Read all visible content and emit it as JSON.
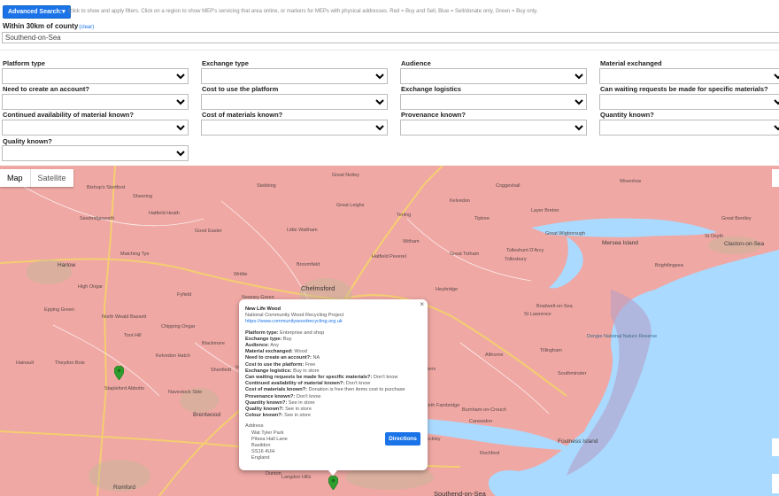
{
  "header": {
    "advanced_search_label": "Advanced Search:▾",
    "help_text": "Click to show and apply filters. Click on a region to show MEP's servicing that area online, or markers for MEPs with physical addresses. Red = Buy and Sell, Blue = Sell/donate only, Green = Buy only.",
    "county_label": "Within 30km of county",
    "county_clear": "(clear)",
    "county_value": "Southend-on-Sea"
  },
  "filters": [
    {
      "label": "Platform type"
    },
    {
      "label": "Exchange type"
    },
    {
      "label": "Audience"
    },
    {
      "label": "Material exchanged"
    },
    {
      "label": "Need to create an account?"
    },
    {
      "label": "Cost to use the platform"
    },
    {
      "label": "Exchange logistics"
    },
    {
      "label": "Can waiting requests be made for specific materials?"
    },
    {
      "label": "Continued availability of material known?"
    },
    {
      "label": "Cost of materials known?"
    },
    {
      "label": "Provenance known?"
    },
    {
      "label": "Quantity known?"
    },
    {
      "label": "Quality known?"
    }
  ],
  "map": {
    "type_map": "Map",
    "type_satellite": "Satellite",
    "region_color": "#efa8a4",
    "sea_color": "#aadaff",
    "marker_color": "#2e9e2e",
    "places": [
      {
        "name": "Chelmsford",
        "cls": "big"
      },
      {
        "name": "Harlow",
        "cls": "town"
      },
      {
        "name": "Brentwood",
        "cls": "town"
      },
      {
        "name": "Romford",
        "cls": "town"
      },
      {
        "name": "Basildon",
        "cls": "town"
      },
      {
        "name": "Southend-on-Sea",
        "cls": "big"
      },
      {
        "name": "Clacton-on-Sea",
        "cls": "town"
      },
      {
        "name": "Foulness Island",
        "cls": "town"
      },
      {
        "name": "Mersea Island",
        "cls": "town"
      },
      {
        "name": "Burnham-on-Crouch",
        "cls": ""
      },
      {
        "name": "Dengie National Nature Reserve",
        "cls": "water"
      },
      {
        "name": "Epping Green",
        "cls": ""
      },
      {
        "name": "North Weald Bassett",
        "cls": ""
      },
      {
        "name": "Stapleford Abbotts",
        "cls": ""
      },
      {
        "name": "Theydon Bois",
        "cls": ""
      },
      {
        "name": "Toot Hill",
        "cls": ""
      },
      {
        "name": "Blackmore",
        "cls": ""
      },
      {
        "name": "Maldon",
        "cls": "town"
      },
      {
        "name": "Great Notley",
        "cls": ""
      },
      {
        "name": "Great Leighs",
        "cls": ""
      },
      {
        "name": "Terling",
        "cls": ""
      },
      {
        "name": "Tiptree",
        "cls": ""
      },
      {
        "name": "Tollesbury",
        "cls": ""
      },
      {
        "name": "Tolleshunt D'Arcy",
        "cls": ""
      },
      {
        "name": "St Lawrence",
        "cls": ""
      },
      {
        "name": "Bradwell-on-Sea",
        "cls": ""
      },
      {
        "name": "Tillingham",
        "cls": ""
      },
      {
        "name": "Canewdon",
        "cls": ""
      },
      {
        "name": "Hockley",
        "cls": ""
      },
      {
        "name": "Bishop's Stortford",
        "cls": ""
      },
      {
        "name": "Sawbridgeworth",
        "cls": ""
      },
      {
        "name": "Hatfield Heath",
        "cls": ""
      },
      {
        "name": "Matching Tye",
        "cls": ""
      },
      {
        "name": "High Ongar",
        "cls": ""
      },
      {
        "name": "Fyfield",
        "cls": ""
      },
      {
        "name": "Writtle",
        "cls": ""
      },
      {
        "name": "Broomfield",
        "cls": ""
      },
      {
        "name": "Little Baddow",
        "cls": ""
      },
      {
        "name": "Witham",
        "cls": ""
      },
      {
        "name": "Great Totham",
        "cls": ""
      },
      {
        "name": "Heybridge",
        "cls": ""
      },
      {
        "name": "Great Wigborough",
        "cls": ""
      },
      {
        "name": "Layer Breton",
        "cls": ""
      },
      {
        "name": "Kelvedon",
        "cls": ""
      },
      {
        "name": "St Osyth",
        "cls": ""
      },
      {
        "name": "Great Bentley",
        "cls": ""
      },
      {
        "name": "Wivenhoe",
        "cls": ""
      },
      {
        "name": "Rochford",
        "cls": ""
      },
      {
        "name": "South Woodham Ferrers",
        "cls": ""
      },
      {
        "name": "Rayleigh",
        "cls": ""
      },
      {
        "name": "Langdon Hills",
        "cls": ""
      },
      {
        "name": "Kelvedon Hatch",
        "cls": ""
      },
      {
        "name": "Navestock Side",
        "cls": ""
      },
      {
        "name": "Chipping Ongar",
        "cls": ""
      },
      {
        "name": "Hainault",
        "cls": ""
      },
      {
        "name": "Sheering",
        "cls": ""
      },
      {
        "name": "Good Easter",
        "cls": ""
      },
      {
        "name": "Newney Green",
        "cls": ""
      },
      {
        "name": "Latchingdon",
        "cls": ""
      },
      {
        "name": "North Fambridge",
        "cls": ""
      },
      {
        "name": "Althorne",
        "cls": ""
      },
      {
        "name": "Southminster",
        "cls": ""
      },
      {
        "name": "Stebbing",
        "cls": ""
      },
      {
        "name": "Coggeshall",
        "cls": ""
      },
      {
        "name": "Brightlingsea",
        "cls": ""
      },
      {
        "name": "Little Waltham",
        "cls": ""
      },
      {
        "name": "Hatfield Peverel",
        "cls": ""
      },
      {
        "name": "Ingatestone",
        "cls": ""
      },
      {
        "name": "Shenfield",
        "cls": ""
      },
      {
        "name": "Billericay",
        "cls": ""
      },
      {
        "name": "Wickford",
        "cls": ""
      },
      {
        "name": "Dunton",
        "cls": ""
      }
    ]
  },
  "popup": {
    "close": "×",
    "name": "New Life Wood",
    "org": "National Community Wood Recycling Project",
    "url": "https://www.communitywoodrecycling.org.uk",
    "rows": [
      {
        "k": "Platform type:",
        "v": "Enterprise and shop"
      },
      {
        "k": "Exchange type:",
        "v": "Buy"
      },
      {
        "k": "Audience:",
        "v": "Any"
      },
      {
        "k": "Material exchanged:",
        "v": "Wood"
      },
      {
        "k": "Need to create an account?:",
        "v": "NA"
      },
      {
        "k": "Cost to use the platform:",
        "v": "Free"
      },
      {
        "k": "Exchange logistics:",
        "v": "Buy in store"
      },
      {
        "k": "Can waiting requests be made for specific materials?:",
        "v": "Don't know"
      },
      {
        "k": "Continued availability of material known?:",
        "v": "Don't know"
      },
      {
        "k": "Cost of materials known?:",
        "v": "Donation is free then items cost to purchase"
      },
      {
        "k": "Provenance known?:",
        "v": "Don't know"
      },
      {
        "k": "Quantity known?:",
        "v": "See in store"
      },
      {
        "k": "Quality known?:",
        "v": "See in store"
      },
      {
        "k": "Colour known?:",
        "v": "See in store"
      }
    ],
    "address_label": "Address",
    "address": [
      "Wat Tyler Park",
      "Pitsea Hall Lane",
      "Basildon",
      "SS16 4UH",
      "England"
    ],
    "directions": "Directions"
  }
}
